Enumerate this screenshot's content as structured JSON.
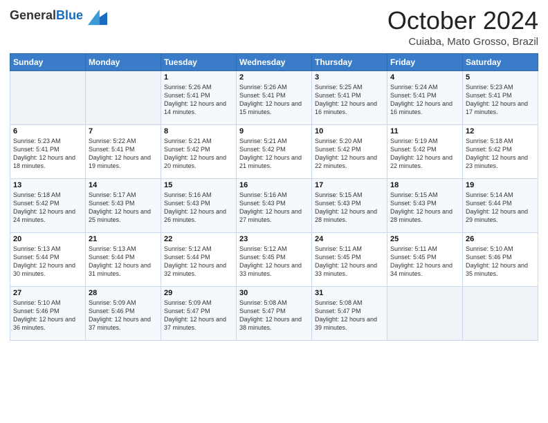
{
  "header": {
    "logo_general": "General",
    "logo_blue": "Blue",
    "month_title": "October 2024",
    "location": "Cuiaba, Mato Grosso, Brazil"
  },
  "weekdays": [
    "Sunday",
    "Monday",
    "Tuesday",
    "Wednesday",
    "Thursday",
    "Friday",
    "Saturday"
  ],
  "weeks": [
    [
      {
        "day": "",
        "sunrise": "",
        "sunset": "",
        "daylight": ""
      },
      {
        "day": "",
        "sunrise": "",
        "sunset": "",
        "daylight": ""
      },
      {
        "day": "1",
        "sunrise": "Sunrise: 5:26 AM",
        "sunset": "Sunset: 5:41 PM",
        "daylight": "Daylight: 12 hours and 14 minutes."
      },
      {
        "day": "2",
        "sunrise": "Sunrise: 5:26 AM",
        "sunset": "Sunset: 5:41 PM",
        "daylight": "Daylight: 12 hours and 15 minutes."
      },
      {
        "day": "3",
        "sunrise": "Sunrise: 5:25 AM",
        "sunset": "Sunset: 5:41 PM",
        "daylight": "Daylight: 12 hours and 16 minutes."
      },
      {
        "day": "4",
        "sunrise": "Sunrise: 5:24 AM",
        "sunset": "Sunset: 5:41 PM",
        "daylight": "Daylight: 12 hours and 16 minutes."
      },
      {
        "day": "5",
        "sunrise": "Sunrise: 5:23 AM",
        "sunset": "Sunset: 5:41 PM",
        "daylight": "Daylight: 12 hours and 17 minutes."
      }
    ],
    [
      {
        "day": "6",
        "sunrise": "Sunrise: 5:23 AM",
        "sunset": "Sunset: 5:41 PM",
        "daylight": "Daylight: 12 hours and 18 minutes."
      },
      {
        "day": "7",
        "sunrise": "Sunrise: 5:22 AM",
        "sunset": "Sunset: 5:41 PM",
        "daylight": "Daylight: 12 hours and 19 minutes."
      },
      {
        "day": "8",
        "sunrise": "Sunrise: 5:21 AM",
        "sunset": "Sunset: 5:42 PM",
        "daylight": "Daylight: 12 hours and 20 minutes."
      },
      {
        "day": "9",
        "sunrise": "Sunrise: 5:21 AM",
        "sunset": "Sunset: 5:42 PM",
        "daylight": "Daylight: 12 hours and 21 minutes."
      },
      {
        "day": "10",
        "sunrise": "Sunrise: 5:20 AM",
        "sunset": "Sunset: 5:42 PM",
        "daylight": "Daylight: 12 hours and 22 minutes."
      },
      {
        "day": "11",
        "sunrise": "Sunrise: 5:19 AM",
        "sunset": "Sunset: 5:42 PM",
        "daylight": "Daylight: 12 hours and 22 minutes."
      },
      {
        "day": "12",
        "sunrise": "Sunrise: 5:18 AM",
        "sunset": "Sunset: 5:42 PM",
        "daylight": "Daylight: 12 hours and 23 minutes."
      }
    ],
    [
      {
        "day": "13",
        "sunrise": "Sunrise: 5:18 AM",
        "sunset": "Sunset: 5:42 PM",
        "daylight": "Daylight: 12 hours and 24 minutes."
      },
      {
        "day": "14",
        "sunrise": "Sunrise: 5:17 AM",
        "sunset": "Sunset: 5:43 PM",
        "daylight": "Daylight: 12 hours and 25 minutes."
      },
      {
        "day": "15",
        "sunrise": "Sunrise: 5:16 AM",
        "sunset": "Sunset: 5:43 PM",
        "daylight": "Daylight: 12 hours and 26 minutes."
      },
      {
        "day": "16",
        "sunrise": "Sunrise: 5:16 AM",
        "sunset": "Sunset: 5:43 PM",
        "daylight": "Daylight: 12 hours and 27 minutes."
      },
      {
        "day": "17",
        "sunrise": "Sunrise: 5:15 AM",
        "sunset": "Sunset: 5:43 PM",
        "daylight": "Daylight: 12 hours and 28 minutes."
      },
      {
        "day": "18",
        "sunrise": "Sunrise: 5:15 AM",
        "sunset": "Sunset: 5:43 PM",
        "daylight": "Daylight: 12 hours and 28 minutes."
      },
      {
        "day": "19",
        "sunrise": "Sunrise: 5:14 AM",
        "sunset": "Sunset: 5:44 PM",
        "daylight": "Daylight: 12 hours and 29 minutes."
      }
    ],
    [
      {
        "day": "20",
        "sunrise": "Sunrise: 5:13 AM",
        "sunset": "Sunset: 5:44 PM",
        "daylight": "Daylight: 12 hours and 30 minutes."
      },
      {
        "day": "21",
        "sunrise": "Sunrise: 5:13 AM",
        "sunset": "Sunset: 5:44 PM",
        "daylight": "Daylight: 12 hours and 31 minutes."
      },
      {
        "day": "22",
        "sunrise": "Sunrise: 5:12 AM",
        "sunset": "Sunset: 5:44 PM",
        "daylight": "Daylight: 12 hours and 32 minutes."
      },
      {
        "day": "23",
        "sunrise": "Sunrise: 5:12 AM",
        "sunset": "Sunset: 5:45 PM",
        "daylight": "Daylight: 12 hours and 33 minutes."
      },
      {
        "day": "24",
        "sunrise": "Sunrise: 5:11 AM",
        "sunset": "Sunset: 5:45 PM",
        "daylight": "Daylight: 12 hours and 33 minutes."
      },
      {
        "day": "25",
        "sunrise": "Sunrise: 5:11 AM",
        "sunset": "Sunset: 5:45 PM",
        "daylight": "Daylight: 12 hours and 34 minutes."
      },
      {
        "day": "26",
        "sunrise": "Sunrise: 5:10 AM",
        "sunset": "Sunset: 5:46 PM",
        "daylight": "Daylight: 12 hours and 35 minutes."
      }
    ],
    [
      {
        "day": "27",
        "sunrise": "Sunrise: 5:10 AM",
        "sunset": "Sunset: 5:46 PM",
        "daylight": "Daylight: 12 hours and 36 minutes."
      },
      {
        "day": "28",
        "sunrise": "Sunrise: 5:09 AM",
        "sunset": "Sunset: 5:46 PM",
        "daylight": "Daylight: 12 hours and 37 minutes."
      },
      {
        "day": "29",
        "sunrise": "Sunrise: 5:09 AM",
        "sunset": "Sunset: 5:47 PM",
        "daylight": "Daylight: 12 hours and 37 minutes."
      },
      {
        "day": "30",
        "sunrise": "Sunrise: 5:08 AM",
        "sunset": "Sunset: 5:47 PM",
        "daylight": "Daylight: 12 hours and 38 minutes."
      },
      {
        "day": "31",
        "sunrise": "Sunrise: 5:08 AM",
        "sunset": "Sunset: 5:47 PM",
        "daylight": "Daylight: 12 hours and 39 minutes."
      },
      {
        "day": "",
        "sunrise": "",
        "sunset": "",
        "daylight": ""
      },
      {
        "day": "",
        "sunrise": "",
        "sunset": "",
        "daylight": ""
      }
    ]
  ]
}
